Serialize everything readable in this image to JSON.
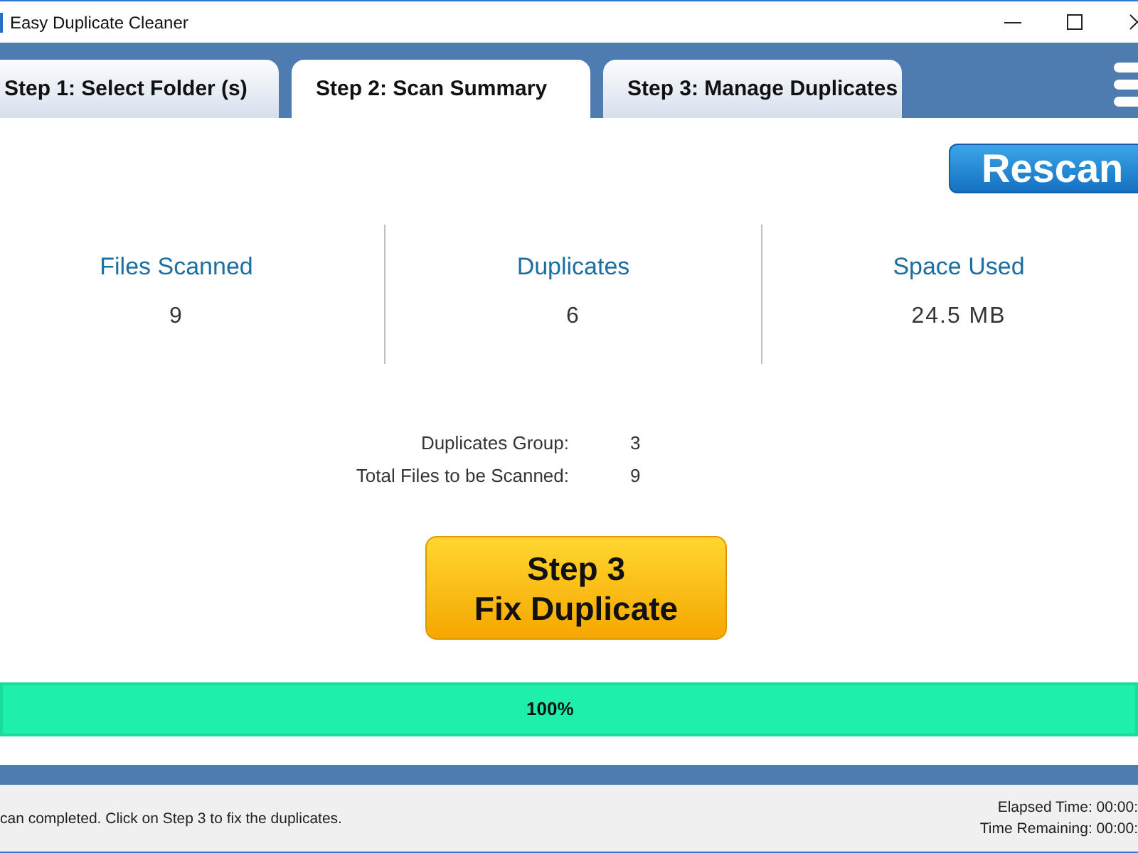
{
  "window": {
    "title": "Easy Duplicate Cleaner"
  },
  "tabs": [
    {
      "label": "Step 1: Select Folder (s)",
      "selected": false
    },
    {
      "label": "Step 2: Scan Summary",
      "selected": true
    },
    {
      "label": "Step 3: Manage Duplicates",
      "selected": false
    }
  ],
  "rescan_button": {
    "label": "Rescan"
  },
  "stats": [
    {
      "label": "Files Scanned",
      "value": "9"
    },
    {
      "label": "Duplicates",
      "value": "6"
    },
    {
      "label": "Space Used",
      "value": "24.5 MB"
    }
  ],
  "details": [
    {
      "label": "Duplicates Group:",
      "value": "3"
    },
    {
      "label": "Total Files to be Scanned:",
      "value": "9"
    }
  ],
  "fix_button": {
    "label": "Step 3\nFix Duplicate"
  },
  "progress": {
    "level": 1,
    "reading": "100%"
  },
  "status_bar": {
    "message": "can completed. Click on Step 3 to fix the duplicates.",
    "times": [
      "Elapsed Time: 00:00:",
      "Time Remaining: 00:00:"
    ]
  }
}
